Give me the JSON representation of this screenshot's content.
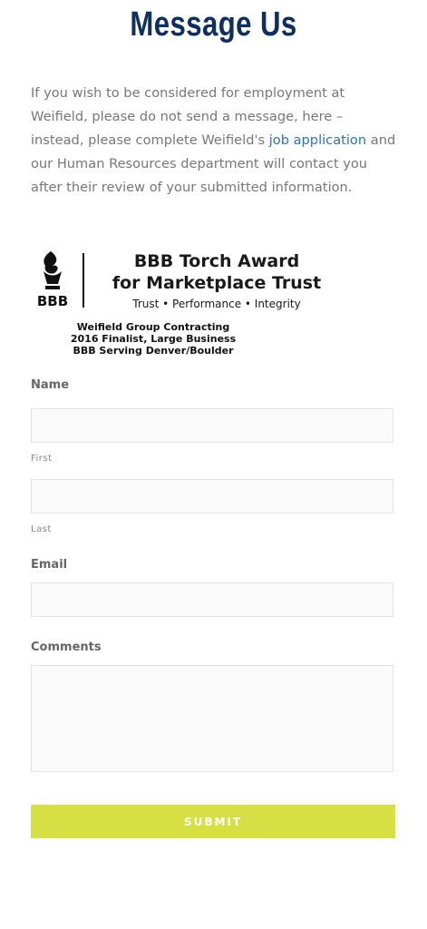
{
  "page": {
    "title": "Message Us",
    "intro": {
      "before": "If you wish to be considered for employment at Weifield, please do not send a message, here – instead, please complete Weifield's ",
      "link": "job application",
      "after": " and our Human Resources department will contact you after their review of your submitted information."
    }
  },
  "award": {
    "logo_text": "BBB",
    "line1": "BBB Torch Award",
    "line2": "for Marketplace Trust",
    "tagline": "Trust • Performance • Integrity",
    "sub1": "Weifield Group Contracting",
    "sub2": "2016 Finalist, Large Business",
    "sub3": "BBB Serving Denver/Boulder"
  },
  "form": {
    "name_label": "Name",
    "first_label": "First",
    "last_label": "Last",
    "email_label": "Email",
    "comments_label": "Comments",
    "first_value": "",
    "last_value": "",
    "email_value": "",
    "comments_value": "",
    "submit_label": "SUBMIT"
  },
  "colors": {
    "title": "#0e2f63",
    "link": "#2a73c2",
    "submit": "#d7e043"
  }
}
